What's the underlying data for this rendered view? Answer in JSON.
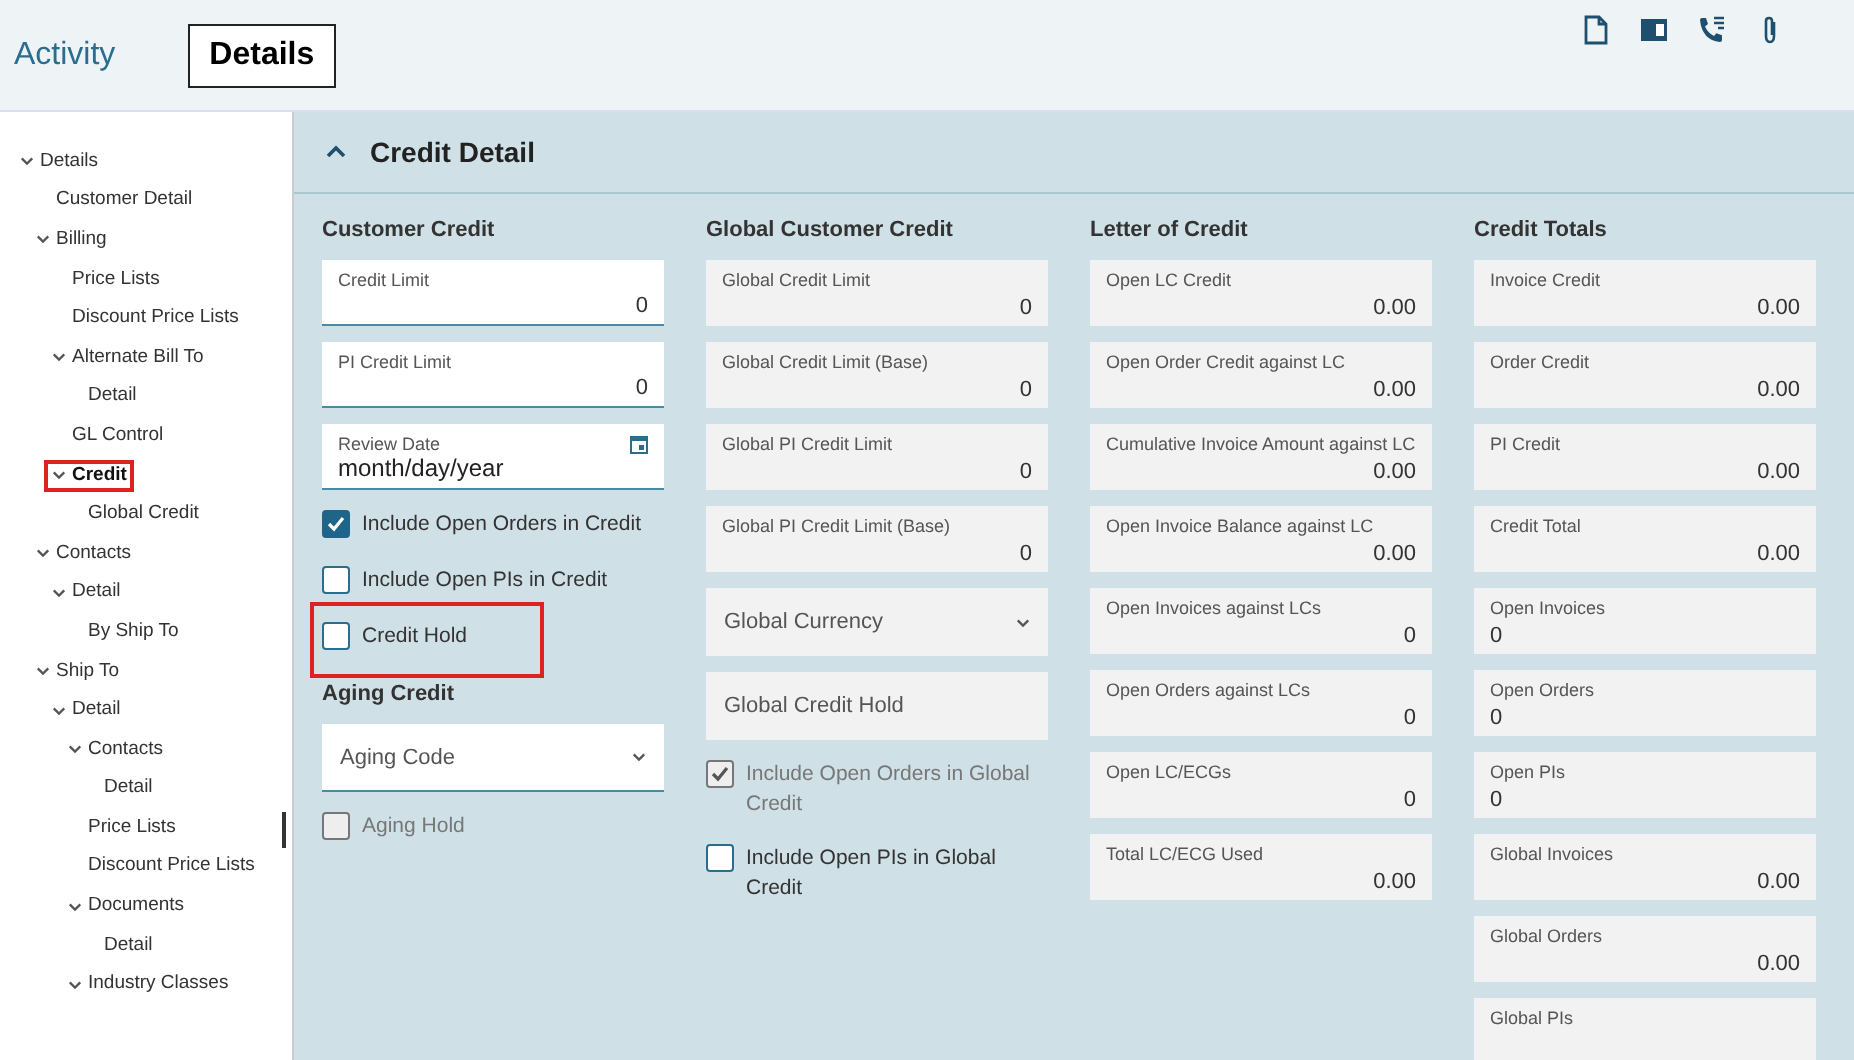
{
  "tabs": [
    {
      "label": "Activity",
      "selected": false
    },
    {
      "label": "Details",
      "selected": true
    }
  ],
  "sidebar": {
    "tree": [
      {
        "label": "Details",
        "expanded": true,
        "selected": false,
        "highlighted": false,
        "children": [
          {
            "label": "Customer Detail",
            "selected": false,
            "highlighted": false
          },
          {
            "label": "Billing",
            "expanded": true,
            "selected": false,
            "highlighted": false,
            "children": [
              {
                "label": "Price Lists",
                "selected": false,
                "highlighted": false
              },
              {
                "label": "Discount Price Lists",
                "selected": false,
                "highlighted": false
              },
              {
                "label": "Alternate Bill To",
                "expanded": true,
                "selected": false,
                "highlighted": false,
                "children": [
                  {
                    "label": "Detail",
                    "selected": false,
                    "highlighted": false
                  }
                ]
              },
              {
                "label": "GL Control",
                "selected": false,
                "highlighted": false
              },
              {
                "label": "Credit",
                "expanded": true,
                "selected": true,
                "highlighted": true,
                "children": [
                  {
                    "label": "Global Credit",
                    "selected": false,
                    "highlighted": false
                  }
                ]
              }
            ]
          },
          {
            "label": "Contacts",
            "expanded": true,
            "selected": false,
            "highlighted": false,
            "children": [
              {
                "label": "Detail",
                "expanded": true,
                "selected": false,
                "highlighted": false,
                "children": [
                  {
                    "label": "By Ship To",
                    "selected": false,
                    "highlighted": false
                  }
                ]
              }
            ]
          },
          {
            "label": "Ship To",
            "expanded": true,
            "selected": false,
            "highlighted": false,
            "children": [
              {
                "label": "Detail",
                "expanded": true,
                "selected": false,
                "highlighted": false,
                "children": [
                  {
                    "label": "Contacts",
                    "expanded": true,
                    "selected": false,
                    "highlighted": false,
                    "children": [
                      {
                        "label": "Detail",
                        "selected": false,
                        "highlighted": false
                      }
                    ]
                  },
                  {
                    "label": "Price Lists",
                    "selected": false,
                    "highlighted": false
                  },
                  {
                    "label": "Discount Price Lists",
                    "selected": false,
                    "highlighted": false
                  },
                  {
                    "label": "Documents",
                    "expanded": true,
                    "selected": false,
                    "highlighted": false,
                    "children": [
                      {
                        "label": "Detail",
                        "selected": false,
                        "highlighted": false
                      }
                    ]
                  },
                  {
                    "label": "Industry Classes",
                    "expanded": true,
                    "selected": false,
                    "highlighted": false
                  }
                ]
              }
            ]
          }
        ]
      }
    ]
  },
  "section": {
    "title": "Credit Detail",
    "expanded": true
  },
  "columns": [
    {
      "heading": "Customer Credit",
      "items": [
        {
          "kind": "input",
          "label": "Credit Limit",
          "value": "0"
        },
        {
          "kind": "input",
          "label": "PI Credit Limit",
          "value": "0"
        },
        {
          "kind": "date",
          "label": "Review Date",
          "placeholder": "month/day/year"
        },
        {
          "kind": "checkbox",
          "label": "Include Open Orders in Credit",
          "checked": true,
          "disabled": false,
          "highlighted": false
        },
        {
          "kind": "checkbox",
          "label": "Include Open PIs in Credit",
          "checked": false,
          "disabled": false,
          "highlighted": false
        },
        {
          "kind": "checkbox",
          "label": "Credit Hold",
          "checked": false,
          "disabled": false,
          "highlighted": true
        },
        {
          "kind": "heading",
          "label": "Aging Credit"
        },
        {
          "kind": "select",
          "label": "Aging Code",
          "disabled": false
        },
        {
          "kind": "checkbox",
          "label": "Aging Hold",
          "checked": false,
          "disabled": true,
          "highlighted": false
        }
      ]
    },
    {
      "heading": "Global Customer Credit",
      "items": [
        {
          "kind": "readonly",
          "label": "Global Credit Limit",
          "value": "0"
        },
        {
          "kind": "readonly",
          "label": "Global Credit Limit (Base)",
          "value": "0"
        },
        {
          "kind": "readonly",
          "label": "Global PI Credit Limit",
          "value": "0"
        },
        {
          "kind": "readonly",
          "label": "Global PI Credit Limit (Base)",
          "value": "0"
        },
        {
          "kind": "select",
          "label": "Global Currency",
          "disabled": true
        },
        {
          "kind": "empty",
          "label": "Global Credit Hold"
        },
        {
          "kind": "checkbox",
          "label": "Include Open Orders in Global Credit",
          "checked": true,
          "disabled": true,
          "highlighted": false
        },
        {
          "kind": "checkbox",
          "label": "Include Open PIs in Global Credit",
          "checked": false,
          "disabled": false,
          "highlighted": false
        }
      ]
    },
    {
      "heading": "Letter of Credit",
      "items": [
        {
          "kind": "readonly",
          "label": "Open LC Credit",
          "value": "0.00"
        },
        {
          "kind": "readonly",
          "label": "Open Order Credit against LC",
          "value": "0.00"
        },
        {
          "kind": "readonly",
          "label": "Cumulative Invoice Amount against LC",
          "value": "0.00"
        },
        {
          "kind": "readonly",
          "label": "Open Invoice Balance against LC",
          "value": "0.00"
        },
        {
          "kind": "readonly",
          "label": "Open Invoices against LCs",
          "value": "0"
        },
        {
          "kind": "readonly",
          "label": "Open Orders against LCs",
          "value": "0"
        },
        {
          "kind": "readonly",
          "label": "Open LC/ECGs",
          "value": "0"
        },
        {
          "kind": "readonly",
          "label": "Total LC/ECG Used",
          "value": "0.00"
        }
      ]
    },
    {
      "heading": "Credit Totals",
      "items": [
        {
          "kind": "readonly",
          "label": "Invoice Credit",
          "value": "0.00"
        },
        {
          "kind": "readonly",
          "label": "Order Credit",
          "value": "0.00"
        },
        {
          "kind": "readonly",
          "label": "PI Credit",
          "value": "0.00"
        },
        {
          "kind": "readonly",
          "label": "Credit Total",
          "value": "0.00"
        },
        {
          "kind": "readonly-left",
          "label": "Open Invoices",
          "value": "0"
        },
        {
          "kind": "readonly-left",
          "label": "Open Orders",
          "value": "0"
        },
        {
          "kind": "readonly-left",
          "label": "Open PIs",
          "value": "0"
        },
        {
          "kind": "readonly",
          "label": "Global Invoices",
          "value": "0.00"
        },
        {
          "kind": "readonly",
          "label": "Global Orders",
          "value": "0.00"
        },
        {
          "kind": "readonly",
          "label": "Global PIs"
        }
      ]
    }
  ]
}
